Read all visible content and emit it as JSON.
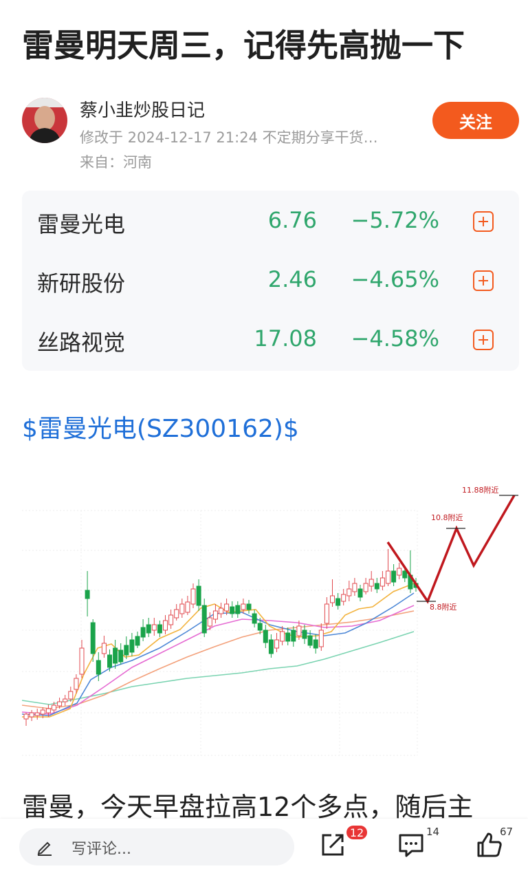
{
  "post": {
    "title": "雷曼明天周三，记得先高抛一下",
    "author": "蔡小韭炒股日记",
    "meta": "修改于  2024-12-17 21:24  不定期分享干货…",
    "location": "来自：河南",
    "follow_label": "关注"
  },
  "stocks": [
    {
      "name": "雷曼光电",
      "price": "6.76",
      "change": "−5.72%"
    },
    {
      "name": "新研股份",
      "price": "2.46",
      "change": "−4.65%"
    },
    {
      "name": "丝路视觉",
      "price": "17.08",
      "change": "−4.58%"
    }
  ],
  "stock_link": "$雷曼光电(SZ300162)$",
  "chart_annotations": {
    "a1": "11.88附近",
    "a2": "10.8附近",
    "a3": "8.8附近"
  },
  "body_text": "雷曼，今天早盘拉高12个多点，随后主",
  "bottom": {
    "comment_placeholder": "写评论...",
    "share_badge": "12",
    "comment_count": "14",
    "like_count": "67"
  },
  "colors": {
    "accent": "#f35a1e",
    "down": "#2fa66c",
    "link": "#1f6fd8",
    "annotation": "#c0181e"
  }
}
